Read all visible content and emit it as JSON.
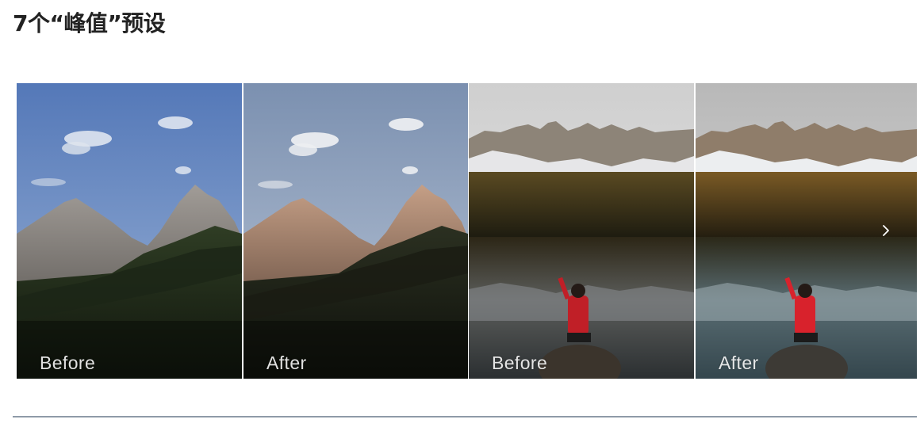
{
  "page": {
    "title": "7个“峰值”预设"
  },
  "gallery": {
    "panels": [
      {
        "label": "Before",
        "scene": "dolomite-peaks",
        "variant": "before"
      },
      {
        "label": "After",
        "scene": "dolomite-peaks",
        "variant": "after"
      },
      {
        "label": "Before",
        "scene": "lake-hiker",
        "variant": "before"
      },
      {
        "label": "After",
        "scene": "lake-hiker",
        "variant": "after"
      }
    ],
    "next_icon": "chevron-right-icon"
  },
  "colors": {
    "title": "#222222",
    "divider": "#8e9aa8",
    "label": "#ffffff"
  }
}
